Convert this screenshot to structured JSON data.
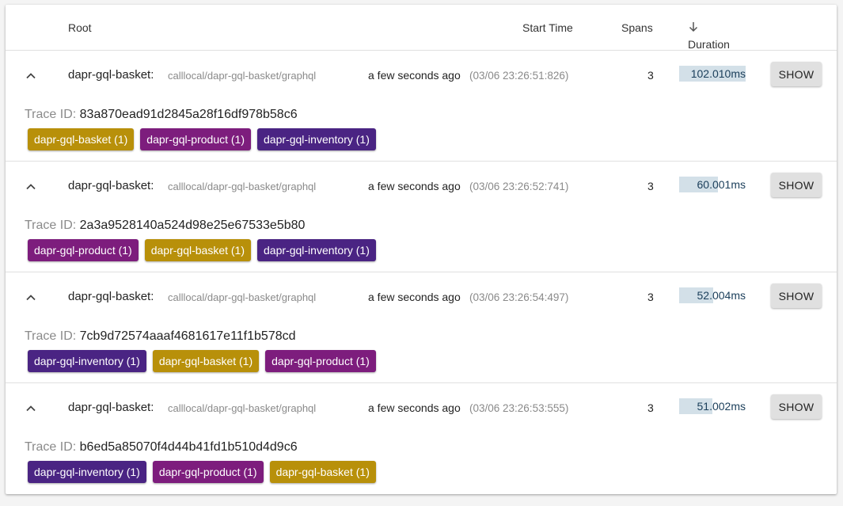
{
  "header": {
    "root_label": "Root",
    "start_time_label": "Start Time",
    "spans_label": "Spans",
    "duration_label": "Duration",
    "sort_icon": "arrow-down-icon"
  },
  "colors": {
    "dapr-gql-basket": "#b8900a",
    "dapr-gql-product": "#7d1d7d",
    "dapr-gql-inventory": "#4a2483"
  },
  "rows": [
    {
      "service": "dapr-gql-basket:",
      "path": "calllocal/dapr-gql-basket/graphql",
      "ago": "a few seconds ago",
      "timestamp": "(03/06 23:26:51:826)",
      "spans": "3",
      "duration": "102.010ms",
      "duration_fraction": 1.0,
      "show_label": "SHOW",
      "trace_id_label": "Trace ID:",
      "trace_id": "83a870ead91d2845a28f16df978b58c6",
      "tags": [
        {
          "label": "dapr-gql-basket (1)",
          "service": "dapr-gql-basket"
        },
        {
          "label": "dapr-gql-product (1)",
          "service": "dapr-gql-product"
        },
        {
          "label": "dapr-gql-inventory (1)",
          "service": "dapr-gql-inventory"
        }
      ]
    },
    {
      "service": "dapr-gql-basket:",
      "path": "calllocal/dapr-gql-basket/graphql",
      "ago": "a few seconds ago",
      "timestamp": "(03/06 23:26:52:741)",
      "spans": "3",
      "duration": "60.001ms",
      "duration_fraction": 0.588,
      "show_label": "SHOW",
      "trace_id_label": "Trace ID:",
      "trace_id": "2a3a9528140a524d98e25e67533e5b80",
      "tags": [
        {
          "label": "dapr-gql-product (1)",
          "service": "dapr-gql-product"
        },
        {
          "label": "dapr-gql-basket (1)",
          "service": "dapr-gql-basket"
        },
        {
          "label": "dapr-gql-inventory (1)",
          "service": "dapr-gql-inventory"
        }
      ]
    },
    {
      "service": "dapr-gql-basket:",
      "path": "calllocal/dapr-gql-basket/graphql",
      "ago": "a few seconds ago",
      "timestamp": "(03/06 23:26:54:497)",
      "spans": "3",
      "duration": "52.004ms",
      "duration_fraction": 0.51,
      "show_label": "SHOW",
      "trace_id_label": "Trace ID:",
      "trace_id": "7cb9d72574aaaf4681617e11f1b578cd",
      "tags": [
        {
          "label": "dapr-gql-inventory (1)",
          "service": "dapr-gql-inventory"
        },
        {
          "label": "dapr-gql-basket (1)",
          "service": "dapr-gql-basket"
        },
        {
          "label": "dapr-gql-product (1)",
          "service": "dapr-gql-product"
        }
      ]
    },
    {
      "service": "dapr-gql-basket:",
      "path": "calllocal/dapr-gql-basket/graphql",
      "ago": "a few seconds ago",
      "timestamp": "(03/06 23:26:53:555)",
      "spans": "3",
      "duration": "51.002ms",
      "duration_fraction": 0.5,
      "show_label": "SHOW",
      "trace_id_label": "Trace ID:",
      "trace_id": "b6ed5a85070f4d44b41fd1b510d4d9c6",
      "tags": [
        {
          "label": "dapr-gql-inventory (1)",
          "service": "dapr-gql-inventory"
        },
        {
          "label": "dapr-gql-product (1)",
          "service": "dapr-gql-product"
        },
        {
          "label": "dapr-gql-basket (1)",
          "service": "dapr-gql-basket"
        }
      ]
    }
  ]
}
